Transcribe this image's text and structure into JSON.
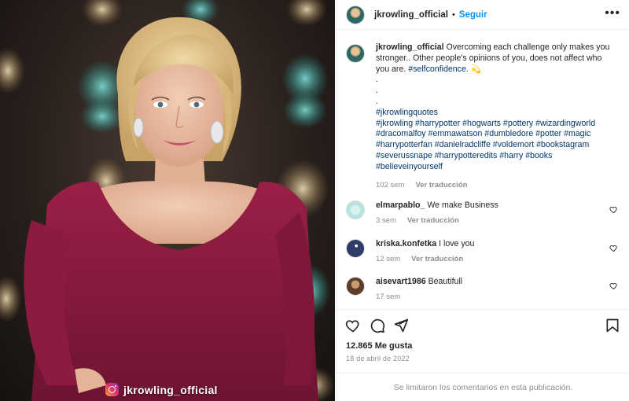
{
  "post": {
    "username": "jkrowling_official",
    "follow_label": "Seguir",
    "more_label": "•••",
    "watermark": "jkrowling_official"
  },
  "caption": {
    "username": "jkrowling_official",
    "text": "Overcoming each challenge only makes you stronger.. Other people's opinions of you, does not affect who you are.",
    "hashtag_inline": "#selfconfidence.",
    "emoji": "💫",
    "dots": [
      ".",
      ".",
      "."
    ],
    "hashtag_lines": [
      "#jkrowlingquotes",
      "#jkrowling #harrypotter #hogwarts #pottery #wizardingworld",
      "#dracomalfoy #emmawatson #dumbledore #potter #magic",
      "#harrypotterfan #danielradcliffe #voldemort #bookstagram",
      "#severussnape #harrypotteredits #harry #books",
      "#believeinyourself"
    ],
    "age": "102 sem",
    "translate": "Ver traducción"
  },
  "comments": [
    {
      "username": "elmarpablo_",
      "text": "We make Business",
      "age": "3 sem",
      "translate": "Ver traducción"
    },
    {
      "username": "kriska.konfetka",
      "text": "I love you",
      "age": "12 sem",
      "translate": "Ver traducción"
    },
    {
      "username": "aisevart1986",
      "text": "Beautifull",
      "age": "17 sem"
    }
  ],
  "stats": {
    "likes": "12.865 Me gusta",
    "date": "18 de abril de 2022"
  },
  "footer": {
    "limited": "Se limitaron los comentarios en esta publicación."
  },
  "icons": {
    "like": "heart-icon",
    "comment": "comment-icon",
    "share": "share-icon",
    "save": "bookmark-icon"
  },
  "colors": {
    "accent": "#0095f6",
    "hashtag": "#00376b",
    "muted": "#8e8e8e",
    "dress": "#8b1c3f"
  }
}
